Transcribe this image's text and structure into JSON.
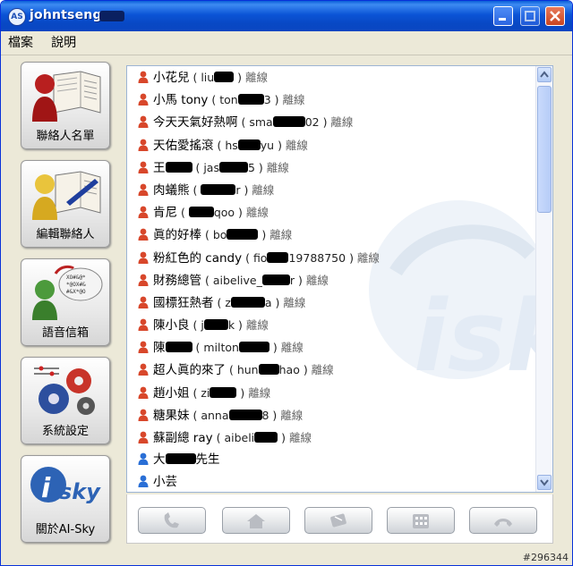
{
  "window": {
    "title": "johntseng"
  },
  "menu": [
    {
      "label": "檔案"
    },
    {
      "label": "說明"
    }
  ],
  "sidebar": {
    "items": [
      {
        "label": "聯絡人名單",
        "icon": "contacts-book-icon"
      },
      {
        "label": "編輯聯絡人",
        "icon": "edit-contact-icon"
      },
      {
        "label": "語音信箱",
        "icon": "voicemail-icon"
      },
      {
        "label": "系統設定",
        "icon": "settings-gears-icon"
      },
      {
        "label": "關於AI-Sky",
        "icon": "ai-sky-logo-icon"
      }
    ]
  },
  "contacts": [
    {
      "name": "小花兒",
      "acct": "liu",
      "acct_end": "",
      "status": "離線",
      "presence": "offline"
    },
    {
      "name": "小馬 tony",
      "acct": "ton",
      "acct_end": "3",
      "status": "離線",
      "presence": "offline"
    },
    {
      "name": "今天天氣好熱啊",
      "acct": "sma",
      "acct_end": "02",
      "status": "離線",
      "presence": "offline"
    },
    {
      "name": "天佑愛搖滾",
      "acct": "hs",
      "acct_end": "yu",
      "status": "離線",
      "presence": "offline"
    },
    {
      "name": "王",
      "acct": "jas",
      "acct_end": "5",
      "status": "離線",
      "presence": "offline"
    },
    {
      "name": "肉蟻熊",
      "acct": "",
      "acct_end": "r",
      "status": "離線",
      "presence": "offline"
    },
    {
      "name": "肯尼",
      "acct": "",
      "acct_end": "qoo",
      "status": "離線",
      "presence": "offline"
    },
    {
      "name": "眞的好棒",
      "acct": "bo",
      "acct_end": "",
      "status": "離線",
      "presence": "offline"
    },
    {
      "name": "粉紅色的 candy",
      "acct": "fio",
      "acct_end": "19788750",
      "status": "離線",
      "presence": "offline"
    },
    {
      "name": "財務總管",
      "acct": "aibelive_",
      "acct_end": "r",
      "status": "離線",
      "presence": "offline"
    },
    {
      "name": "國標狂熱者",
      "acct": "z",
      "acct_end": "a",
      "status": "離線",
      "presence": "offline"
    },
    {
      "name": "陳小良",
      "acct": "j",
      "acct_end": "k",
      "status": "離線",
      "presence": "offline"
    },
    {
      "name": "陳",
      "acct": "milton",
      "acct_end": "",
      "status": "離線",
      "presence": "offline"
    },
    {
      "name": "超人眞的來了",
      "acct": "hun",
      "acct_end": "hao",
      "status": "離線",
      "presence": "offline"
    },
    {
      "name": "趙小姐",
      "acct": "zi",
      "acct_end": "",
      "status": "離線",
      "presence": "offline"
    },
    {
      "name": "糖果妹",
      "acct": "anna",
      "acct_end": "8",
      "status": "離線",
      "presence": "offline"
    },
    {
      "name": "蘇副總 ray",
      "acct": "aibeli",
      "acct_end": "",
      "status": "離線",
      "presence": "offline"
    },
    {
      "name": "大",
      "acct": "",
      "acct_end": "先生",
      "status": "",
      "presence": "online"
    },
    {
      "name": "小芸",
      "acct": "",
      "acct_end": "",
      "status": "",
      "presence": "online"
    }
  ],
  "actions": [
    {
      "name": "call-button",
      "icon": "phone-icon"
    },
    {
      "name": "home-button",
      "icon": "home-icon"
    },
    {
      "name": "sms-button",
      "icon": "mobile-message-icon"
    },
    {
      "name": "keypad-button",
      "icon": "keypad-icon"
    },
    {
      "name": "hangup-button",
      "icon": "hangup-icon"
    }
  ],
  "watermark_text": "isky",
  "image_tag": "#296344",
  "colors": {
    "title_bar": "#0b54d6",
    "panel_border": "#9cb4d4",
    "offline_icon": "#d8472b",
    "online_icon": "#2a6fd6"
  }
}
